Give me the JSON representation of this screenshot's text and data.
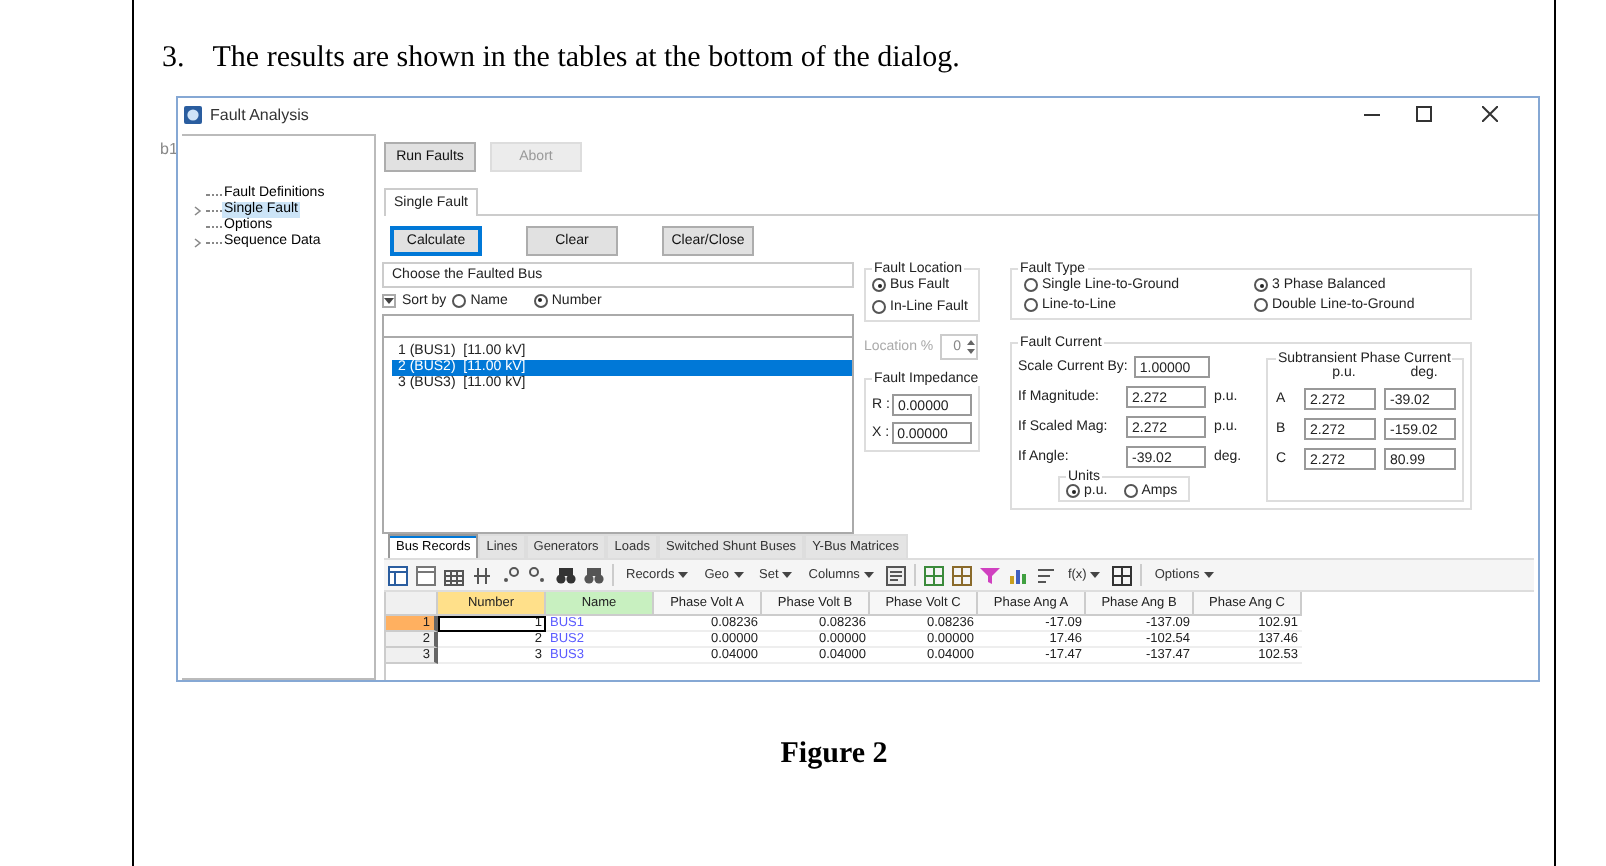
{
  "document": {
    "step_number": "3.",
    "step_text": "The results are shown in the tables at the bottom of the dialog.",
    "caption": "Figure 2"
  },
  "background_fragment": "b1",
  "window": {
    "title": "Fault Analysis"
  },
  "tree": [
    {
      "label": "Fault Definitions",
      "expandable": false,
      "selected": false
    },
    {
      "label": "Single Fault",
      "expandable": true,
      "selected": true
    },
    {
      "label": "Options",
      "expandable": false,
      "selected": false
    },
    {
      "label": "Sequence Data",
      "expandable": true,
      "selected": false
    }
  ],
  "run_buttons": [
    {
      "label": "Run Faults",
      "disabled": false
    },
    {
      "label": "Abort",
      "disabled": true
    }
  ],
  "tabs": [
    {
      "label": "Single Fault",
      "selected": true
    }
  ],
  "action_buttons": [
    {
      "label": "Calculate",
      "focused": true
    },
    {
      "label": "Clear",
      "focused": false
    },
    {
      "label": "Clear/Close",
      "focused": false
    }
  ],
  "bus_chooser": {
    "title": "Choose the Faulted Bus",
    "sort_label": "Sort by",
    "sort_options": [
      {
        "label": "Name",
        "selected": false
      },
      {
        "label": "Number",
        "selected": true
      }
    ],
    "buses": [
      {
        "label": "1 (BUS1)  [11.00 kV]",
        "selected": false
      },
      {
        "label": "2 (BUS2)  [11.00 kV]",
        "selected": true
      },
      {
        "label": "3 (BUS3)  [11.00 kV]",
        "selected": false
      }
    ]
  },
  "fault_location": {
    "title": "Fault Location",
    "options": [
      {
        "label": "Bus Fault",
        "selected": true
      },
      {
        "label": "In-Line Fault",
        "selected": false
      }
    ]
  },
  "location": {
    "label": "Location %",
    "value": "0",
    "disabled": true
  },
  "fault_impedance": {
    "title": "Fault Impedance",
    "fields": [
      {
        "label": "R :",
        "value": "0.00000"
      },
      {
        "label": "X :",
        "value": "0.00000"
      }
    ]
  },
  "fault_type": {
    "title": "Fault Type",
    "options": [
      {
        "label": "Single Line-to-Ground",
        "selected": false
      },
      {
        "label": "3 Phase Balanced",
        "selected": true
      },
      {
        "label": "Line-to-Line",
        "selected": false
      },
      {
        "label": "Double Line-to-Ground",
        "selected": false
      }
    ]
  },
  "fault_current": {
    "title": "Fault Current",
    "scale_label": "Scale Current By:",
    "scale_value": "1.00000",
    "rows": [
      {
        "label": "If Magnitude:",
        "value": "2.272",
        "unit": "p.u."
      },
      {
        "label": "If Scaled Mag:",
        "value": "2.272",
        "unit": "p.u."
      },
      {
        "label": "If Angle:",
        "value": "-39.02",
        "unit": "deg."
      }
    ],
    "units": {
      "title": "Units",
      "options": [
        {
          "label": "p.u.",
          "selected": true
        },
        {
          "label": "Amps",
          "selected": false
        }
      ]
    },
    "subtransient": {
      "title": "Subtransient Phase Current",
      "headers": [
        "p.u.",
        "deg."
      ],
      "rows": [
        {
          "phase": "A",
          "pu": "2.272",
          "deg": "-39.02"
        },
        {
          "phase": "B",
          "pu": "2.272",
          "deg": "-159.02"
        },
        {
          "phase": "C",
          "pu": "2.272",
          "deg": "80.99"
        }
      ]
    }
  },
  "record_tabs": [
    {
      "label": "Bus Records",
      "selected": true
    },
    {
      "label": "Lines",
      "selected": false
    },
    {
      "label": "Generators",
      "selected": false
    },
    {
      "label": "Loads",
      "selected": false
    },
    {
      "label": "Switched Shunt Buses",
      "selected": false
    },
    {
      "label": "Y-Bus Matrices",
      "selected": false
    }
  ],
  "record_toolbar": {
    "menus": [
      "Records",
      "Geo",
      "Set",
      "Columns"
    ],
    "function_menu": "f(x)",
    "options_menu": "Options"
  },
  "table": {
    "columns": [
      "Number",
      "Name",
      "Phase Volt A",
      "Phase Volt B",
      "Phase Volt C",
      "Phase Ang A",
      "Phase Ang B",
      "Phase Ang C"
    ],
    "rows": [
      {
        "row_label": "1",
        "selected": true,
        "cells": [
          "1",
          "BUS1",
          "0.08236",
          "0.08236",
          "0.08236",
          "-17.09",
          "-137.09",
          "102.91"
        ]
      },
      {
        "row_label": "2",
        "selected": false,
        "cells": [
          "2",
          "BUS2",
          "0.00000",
          "0.00000",
          "0.00000",
          "17.46",
          "-102.54",
          "137.46"
        ]
      },
      {
        "row_label": "3",
        "selected": false,
        "cells": [
          "3",
          "BUS3",
          "0.04000",
          "0.04000",
          "0.04000",
          "-17.47",
          "-137.47",
          "102.53"
        ]
      }
    ]
  }
}
